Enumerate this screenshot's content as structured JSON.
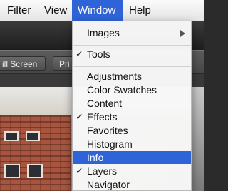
{
  "menubar": {
    "items": [
      {
        "label": "Filter"
      },
      {
        "label": "View"
      },
      {
        "label": "Window"
      },
      {
        "label": "Help"
      }
    ],
    "active": "Window"
  },
  "toolbar": {
    "fullscreen_label": "ill Screen",
    "next_label": "Pri"
  },
  "window_menu": {
    "items": [
      {
        "label": "Images",
        "checked": false,
        "submenu": true
      },
      {
        "label": "Tools",
        "checked": true
      },
      {
        "label": "Adjustments",
        "checked": false
      },
      {
        "label": "Color Swatches",
        "checked": false
      },
      {
        "label": "Content",
        "checked": false
      },
      {
        "label": "Effects",
        "checked": true
      },
      {
        "label": "Favorites",
        "checked": false
      },
      {
        "label": "Histogram",
        "checked": false
      },
      {
        "label": "Info",
        "checked": false,
        "highlighted": true
      },
      {
        "label": "Layers",
        "checked": true
      },
      {
        "label": "Navigator",
        "checked": false
      }
    ],
    "check_glyph": "✓"
  },
  "colors": {
    "menu_highlight": "#2f63d8",
    "menubar_bg": "#f0f0f0",
    "app_bg": "#2b2b2b"
  }
}
